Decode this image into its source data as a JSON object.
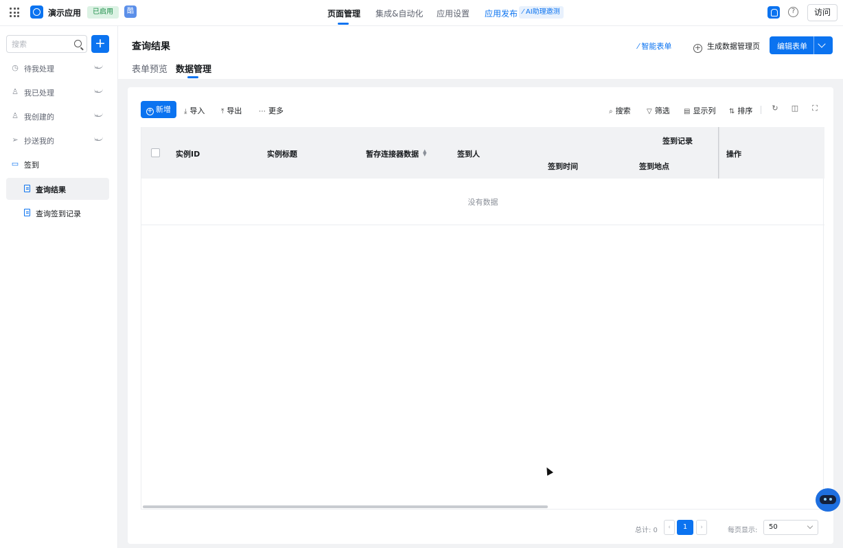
{
  "topbar": {
    "app_name": "演示应用",
    "status_badge": "已启用",
    "ku_badge": "酷",
    "nav": [
      "页面管理",
      "集成&自动化",
      "应用设置",
      "应用发布"
    ],
    "ai_chip": "⁄ AI助理邀测",
    "help": "?",
    "visit_label": "访问"
  },
  "sidebar": {
    "search_placeholder": "搜索",
    "add_label": "+",
    "items": [
      {
        "label": "待我处理"
      },
      {
        "label": "我已处理"
      },
      {
        "label": "我创建的"
      },
      {
        "label": "抄送我的"
      }
    ],
    "group": {
      "label": "签到"
    },
    "sub_items": [
      {
        "label": "查询结果"
      },
      {
        "label": "查询签到记录"
      }
    ]
  },
  "header": {
    "title": "查询结果",
    "tabs": [
      "表单预览",
      "数据管理"
    ],
    "smart_form": "⁄ 智能表单",
    "gen_page": "生成数据管理页",
    "edit_label": "编辑表单"
  },
  "toolbar": {
    "new_label": "新增",
    "import_label": "导入",
    "export_label": "导出",
    "more_label": "更多",
    "search_label": "搜索",
    "filter_label": "筛选",
    "columns_label": "显示列",
    "sort_label": "排序"
  },
  "table": {
    "col_id": "实例ID",
    "col_title": "实例标题",
    "col_temp": "暂存连接器数据",
    "col_person": "签到人",
    "group_record": "签到记录",
    "col_time": "签到时间",
    "col_place": "签到地点",
    "col_ops": "操作",
    "empty_text": "没有数据"
  },
  "pagination": {
    "total": "总计: 0",
    "current_page": "1",
    "page_size_label": "每页显示:",
    "page_size": "50"
  },
  "colors": {
    "accent": "#0b73f0",
    "enabled_badge_bg": "#dcf2e4",
    "enabled_badge_fg": "#1d8e49"
  }
}
